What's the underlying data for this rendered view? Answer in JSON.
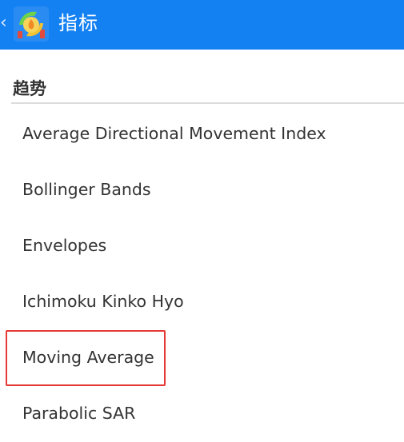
{
  "header": {
    "title": "指标",
    "back_glyph": "‹",
    "background_color": "#1481f2",
    "app_icon": "metatrader-app-icon"
  },
  "section": {
    "title": "趋势"
  },
  "indicators": [
    "Average Directional Movement Index",
    "Bollinger Bands",
    "Envelopes",
    "Ichimoku Kinko Hyo",
    "Moving Average",
    "Parabolic SAR"
  ],
  "highlight": {
    "item": "Moving Average",
    "color": "#e53935"
  }
}
